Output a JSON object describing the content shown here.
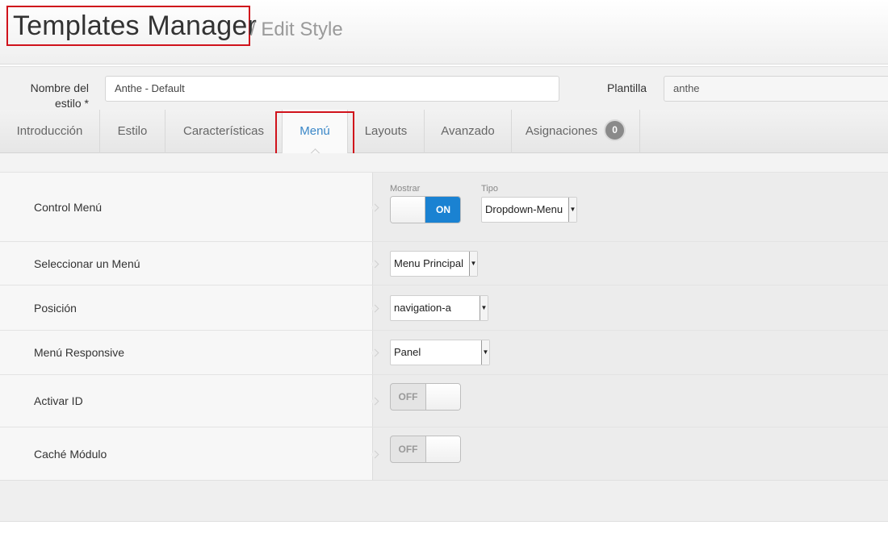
{
  "header": {
    "title": "Templates Manager",
    "subtitle": "/ Edit Style"
  },
  "form": {
    "style_name_label": "Nombre del estilo *",
    "style_name_value": "Anthe - Default",
    "template_label": "Plantilla",
    "template_value": "anthe"
  },
  "tabs": [
    {
      "label": "Introducción"
    },
    {
      "label": "Estilo"
    },
    {
      "label": "Características"
    },
    {
      "label": "Menú"
    },
    {
      "label": "Layouts"
    },
    {
      "label": "Avanzado"
    },
    {
      "label": "Asignaciones",
      "badge": "0"
    }
  ],
  "active_tab": "Menú",
  "settings": {
    "control_menu": {
      "label": "Control Menú",
      "show_label": "Mostrar",
      "show_value": "ON",
      "type_label": "Tipo",
      "type_value": "Dropdown-Menu"
    },
    "select_menu": {
      "label": "Seleccionar un Menú",
      "value": "Menu Principal"
    },
    "position": {
      "label": "Posición",
      "value": "navigation-a"
    },
    "responsive_menu": {
      "label": "Menú Responsive",
      "value": "Panel"
    },
    "activate_id": {
      "label": "Activar ID",
      "value": "OFF"
    },
    "module_cache": {
      "label": "Caché Módulo",
      "value": "OFF"
    }
  },
  "colors": {
    "accent": "#1a82d2",
    "highlight": "#d0121b",
    "active_tab_text": "#3a87c8"
  }
}
